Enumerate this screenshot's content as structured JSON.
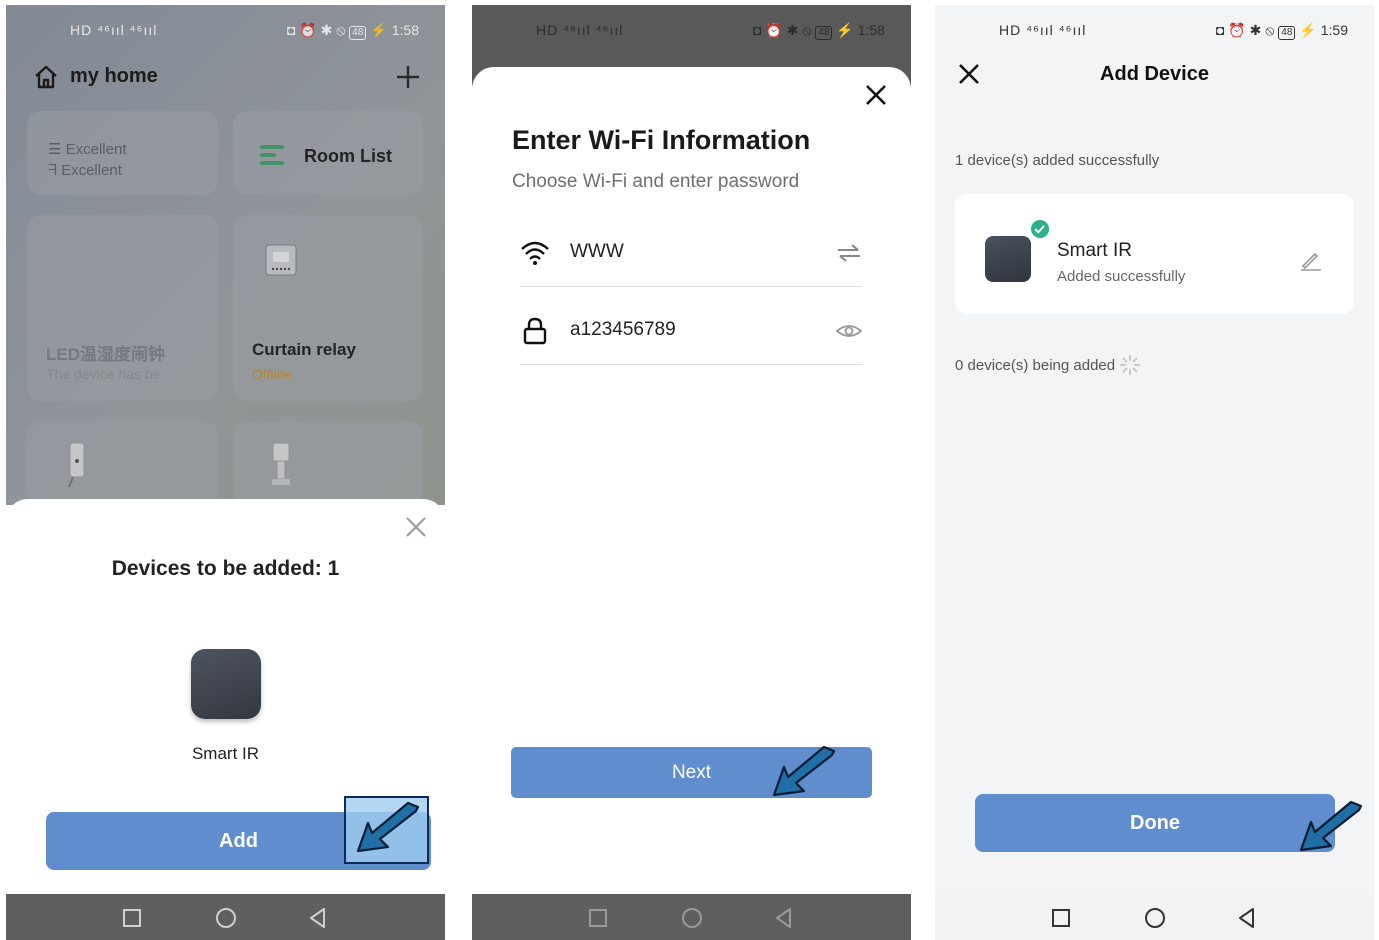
{
  "colors": {
    "primary": "#5f8dce",
    "success": "#2ab08a",
    "arrow": "#1f6fa6",
    "highlight": "#0d2a5c"
  },
  "screen1": {
    "status": {
      "left": "HD ⁴⁶ııl ⁴⁶ııl",
      "right": "48",
      "time": "1:58"
    },
    "home_title": "my home",
    "cards": {
      "network_1": "Excellent",
      "network_2": "Excellent",
      "room_list": "Room List",
      "device_a_name": "LED温湿度闹钟",
      "device_a_status": "The device has be",
      "device_b_name": "Curtain relay",
      "device_b_status": "Offline"
    },
    "sheet": {
      "title": "Devices to be added: 1",
      "device_name": "Smart IR",
      "add_label": "Add"
    }
  },
  "screen2": {
    "status": {
      "left": "HD ⁴⁶ııl ⁴⁶ııl",
      "right": "48",
      "time": "1:58"
    },
    "title": "Enter Wi-Fi Information",
    "subtitle": "Choose Wi-Fi and enter password",
    "wifi_name": "WWW",
    "password": "a123456789",
    "next_label": "Next"
  },
  "screen3": {
    "status": {
      "left": "HD ⁴⁶ııl ⁴⁶ııl",
      "right": "48",
      "time": "1:59"
    },
    "title": "Add Device",
    "added_count": "1 device(s) added successfully",
    "device_name": "Smart IR",
    "device_status": "Added successfully",
    "adding_count": "0 device(s) being added",
    "done_label": "Done"
  }
}
